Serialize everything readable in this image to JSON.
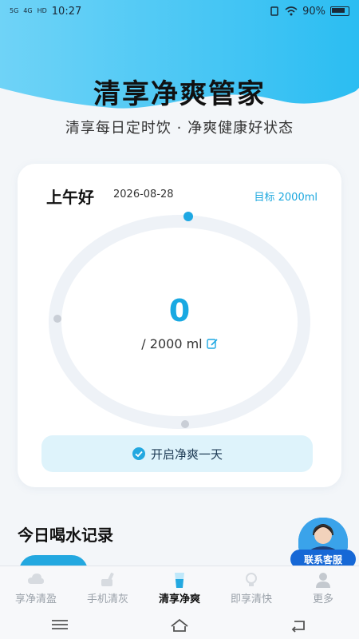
{
  "status_bar": {
    "network_1": "5G",
    "network_2": "4G",
    "hd": "HD",
    "time": "10:27",
    "battery": "90%"
  },
  "header": {
    "title": "清享净爽管家",
    "subtitle": "清享每日定时饮 · 净爽健康好状态"
  },
  "card": {
    "greeting": "上午好",
    "date": "2026-08-28",
    "goal": "目标 2000ml",
    "current_amount": "0",
    "target_text": "/ 2000 ml",
    "progress": 0,
    "start_button": "开启净爽一天"
  },
  "records": {
    "title": "今日喝水记录"
  },
  "customer_service": {
    "label": "联系客服"
  },
  "tabs": [
    {
      "label": "享净清盈",
      "icon": "cloud-icon",
      "active": false
    },
    {
      "label": "手机清灰",
      "icon": "brush-icon",
      "active": false
    },
    {
      "label": "清享净爽",
      "icon": "water-cup-icon",
      "active": true
    },
    {
      "label": "即享清快",
      "icon": "lightbulb-icon",
      "active": false
    },
    {
      "label": "更多",
      "icon": "user-icon",
      "active": false
    }
  ],
  "colors": {
    "accent": "#19a9e2",
    "header_blue": "#5fcdf5",
    "button_bg": "#def3fb",
    "cs_blue": "#1668d6"
  }
}
